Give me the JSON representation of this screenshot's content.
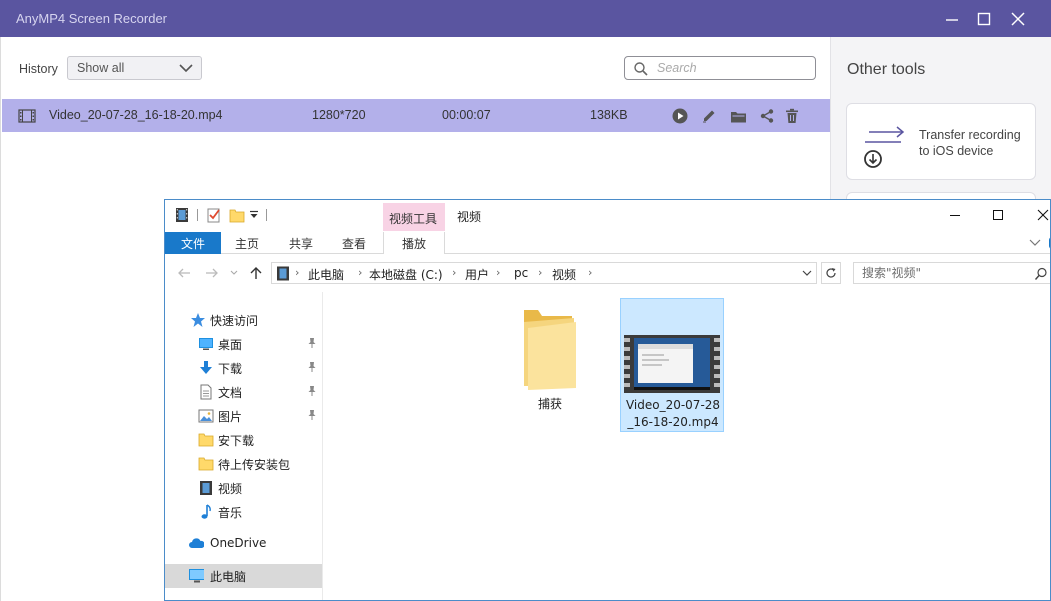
{
  "recorder": {
    "title": "AnyMP4 Screen Recorder",
    "history_label": "History",
    "filter_value": "Show all",
    "search_placeholder": "Search",
    "recording": {
      "name": "Video_20-07-28_16-18-20.mp4",
      "resolution": "1280*720",
      "duration": "00:00:07",
      "size": "138KB"
    },
    "row_actions": [
      "play-icon",
      "edit-icon",
      "folder-icon",
      "share-icon",
      "delete-icon"
    ],
    "other_tools_title": "Other tools",
    "tools": [
      {
        "label": "Transfer recording to iOS device",
        "icon": "transfer-ios-icon"
      }
    ],
    "colors": {
      "titlebar": "#5a55a0",
      "selected_row": "#b3b0ea"
    }
  },
  "explorer": {
    "window_title": "视频",
    "contextual_group": "视频工具",
    "ribbon_tabs": [
      "文件",
      "主页",
      "共享",
      "查看",
      "播放"
    ],
    "breadcrumbs": [
      "此电脑",
      "本地磁盘 (C:)",
      "用户",
      "pc",
      "视频"
    ],
    "search_placeholder": "搜索\"视频\"",
    "nav": {
      "quick_access": "快速访问",
      "items": [
        {
          "label": "桌面",
          "pinned": true,
          "icon": "desktop-icon"
        },
        {
          "label": "下载",
          "pinned": true,
          "icon": "download-icon"
        },
        {
          "label": "文档",
          "pinned": true,
          "icon": "document-icon"
        },
        {
          "label": "图片",
          "pinned": true,
          "icon": "picture-icon"
        },
        {
          "label": "安下载",
          "pinned": false,
          "icon": "folder-icon"
        },
        {
          "label": "待上传安装包",
          "pinned": false,
          "icon": "folder-icon"
        },
        {
          "label": "视频",
          "pinned": false,
          "icon": "video-icon"
        },
        {
          "label": "音乐",
          "pinned": false,
          "icon": "music-icon"
        }
      ],
      "onedrive": "OneDrive",
      "this_pc": "此电脑"
    },
    "files": [
      {
        "name": "捕获",
        "type": "folder"
      },
      {
        "name_line1": "Video_20-07-28",
        "name_line2": "_16-18-20.mp4",
        "type": "video",
        "selected": true
      }
    ]
  }
}
